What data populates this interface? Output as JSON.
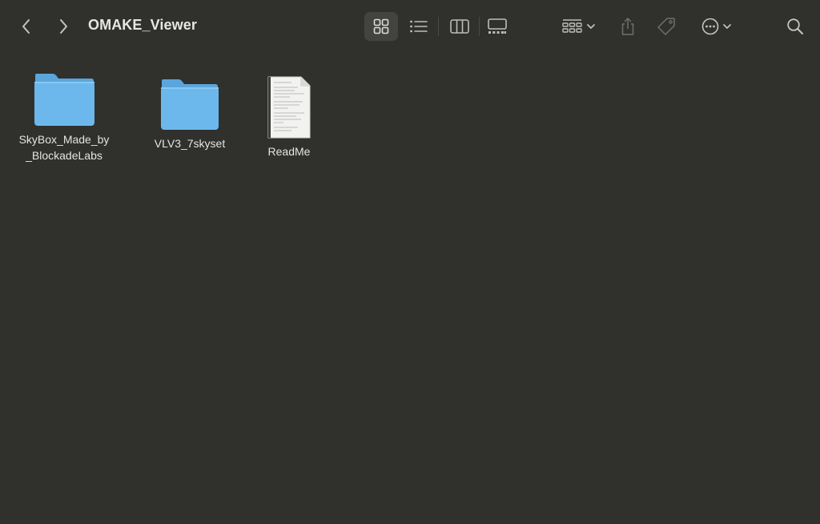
{
  "window": {
    "title": "OMAKE_Viewer"
  },
  "toolbar": {
    "back_icon": "chevron-left-icon",
    "forward_icon": "chevron-right-icon",
    "view_modes": [
      "icon-view",
      "list-view",
      "column-view",
      "gallery-view"
    ],
    "selected_view": "icon-view",
    "group_icon": "group-by-icon",
    "share_icon": "share-icon",
    "tag_icon": "tag-icon",
    "more_icon": "ellipsis-circle-icon",
    "search_icon": "search-icon"
  },
  "files": [
    {
      "name": "SkyBox_Made_by\n_BlockadeLabs",
      "kind": "folder"
    },
    {
      "name": "VLV3_7skyset",
      "kind": "folder"
    },
    {
      "name": "ReadMe",
      "kind": "document"
    }
  ],
  "colors": {
    "background": "#30302d",
    "folder_body": "#6cb8ec",
    "folder_tab": "#5aa6dc"
  }
}
